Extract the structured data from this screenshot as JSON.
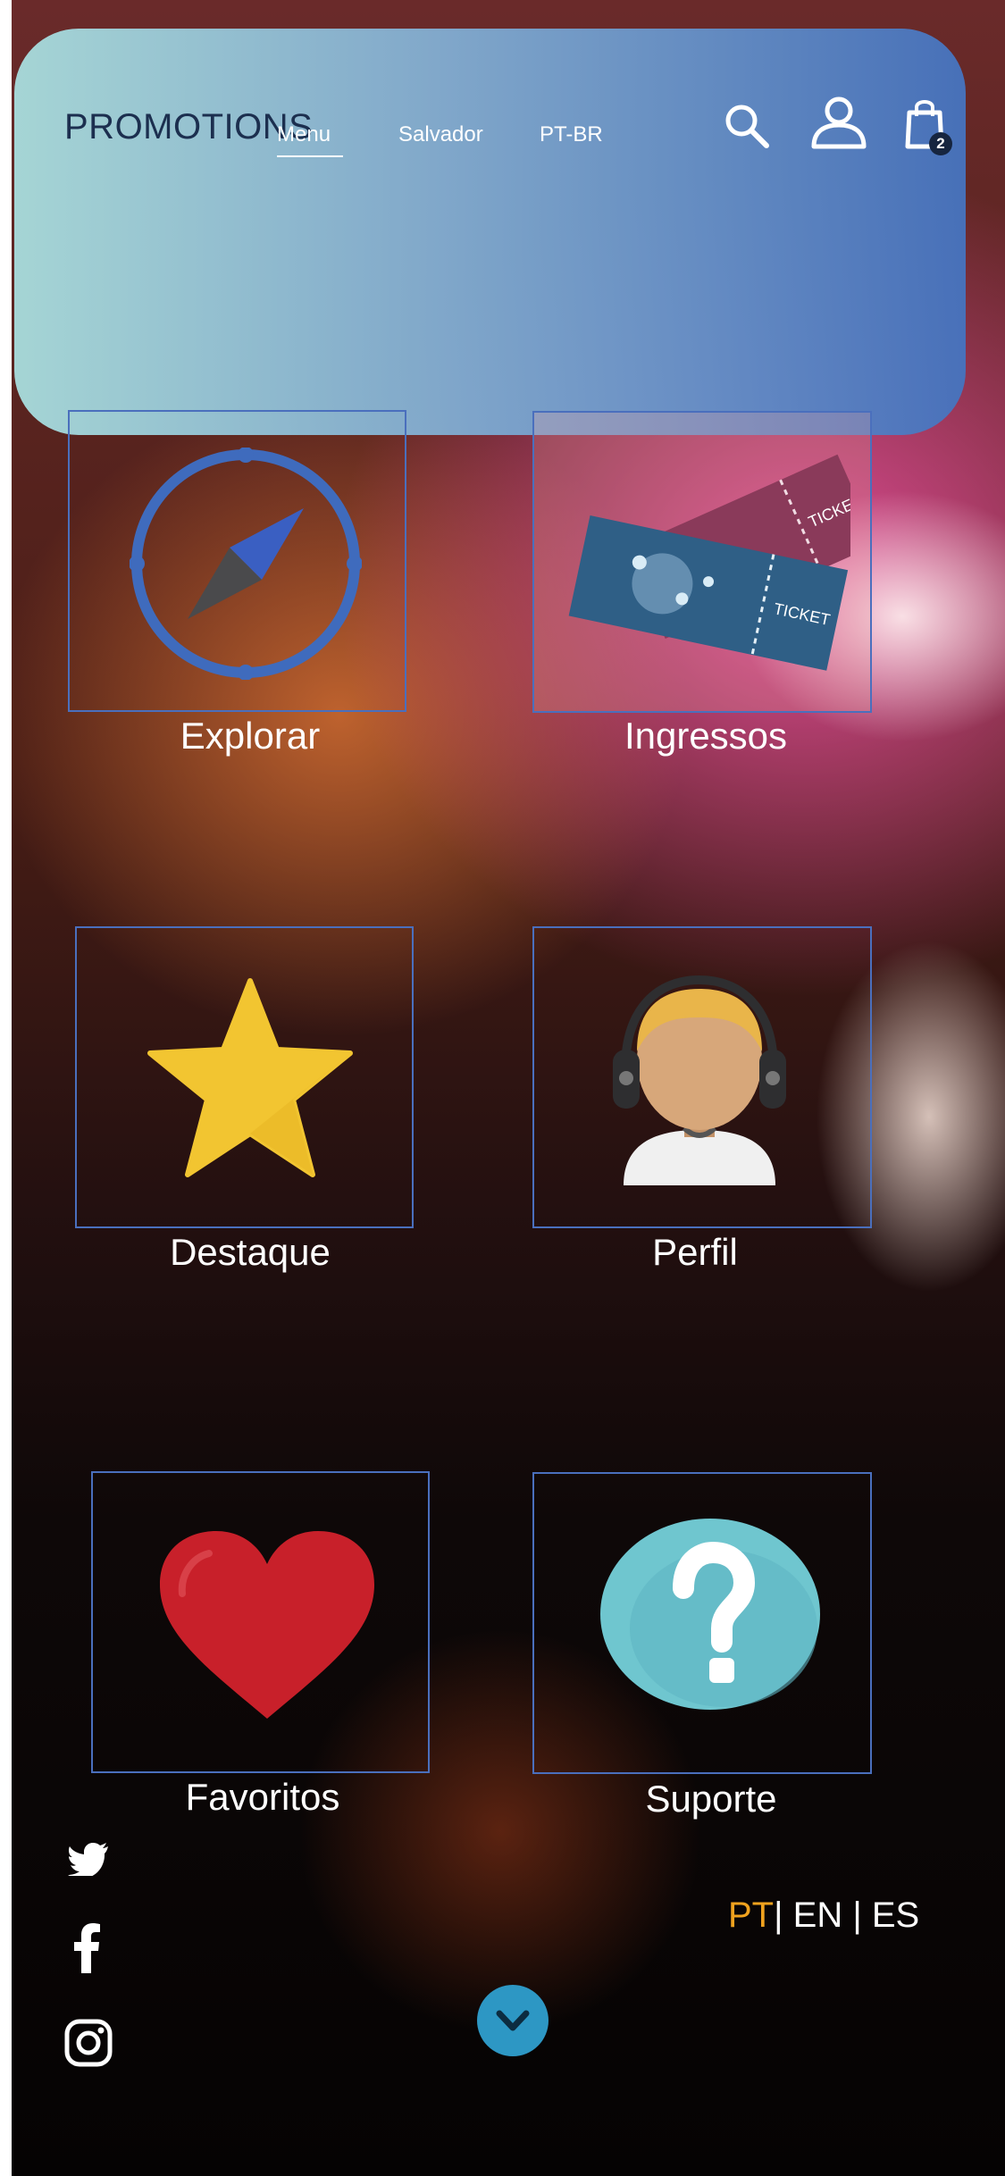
{
  "header": {
    "brand": "PROMOTIONS",
    "nav": {
      "menu": "Menu",
      "city": "Salvador",
      "language": "PT-BR"
    },
    "icons": [
      "search-icon",
      "user-icon",
      "shopping-bag-icon"
    ],
    "cart_count": "2"
  },
  "tiles": [
    {
      "label": "Explorar",
      "icon": "compass-icon"
    },
    {
      "label": "Ingressos",
      "icon": "tickets-icon"
    },
    {
      "label": "Destaque",
      "icon": "star-icon"
    },
    {
      "label": "Perfil",
      "icon": "profile-headphones-icon"
    },
    {
      "label": "Favoritos",
      "icon": "heart-icon"
    },
    {
      "label": "Suporte",
      "icon": "question-icon"
    }
  ],
  "tickets": {
    "text": "TICKET"
  },
  "footer": {
    "social": [
      "twitter-icon",
      "facebook-icon",
      "instagram-icon"
    ],
    "languages": {
      "pt": "PT",
      "sep1": "|",
      "en": "EN",
      "sep2": "|",
      "es": "ES"
    },
    "active_color": "#f0a21e"
  },
  "colors": {
    "tile_border": "#4a6fbd",
    "compass_blue": "#3f6bbd",
    "star": "#f2c531",
    "heart": "#c8202a",
    "help": "#6fc6cf"
  }
}
